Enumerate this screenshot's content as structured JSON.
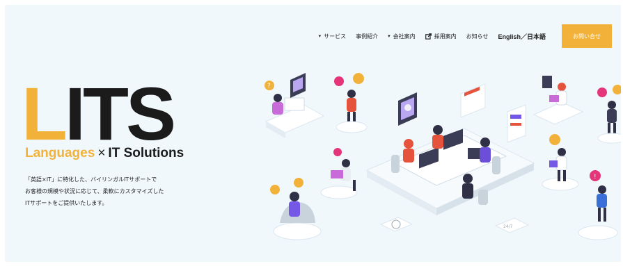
{
  "nav": {
    "items": [
      {
        "label": "サービス",
        "icon": "chevron-down-icon"
      },
      {
        "label": "事例紹介",
        "icon": ""
      },
      {
        "label": "会社案内",
        "icon": "chevron-down-icon"
      },
      {
        "label": "採用案内",
        "icon": "external-link-icon"
      },
      {
        "label": "お知らせ",
        "icon": ""
      },
      {
        "label": "English／日本語",
        "icon": ""
      }
    ],
    "contact_label": "お問い合せ"
  },
  "hero": {
    "logo_first_letter": "L",
    "logo_rest": "ITS",
    "tagline_languages": "Languages",
    "tagline_times": "×",
    "tagline_it": "IT Solutions",
    "description": [
      "「英語×IT」に特化した、バイリンガルITサポートで",
      "お客様の規模や状況に応じて、柔軟にカスタマイズした",
      "ITサポートをご提供いたします。"
    ]
  },
  "colors": {
    "accent": "#f2b23a",
    "hero_bg": "#f0f8fc",
    "text": "#1b1b1b"
  }
}
